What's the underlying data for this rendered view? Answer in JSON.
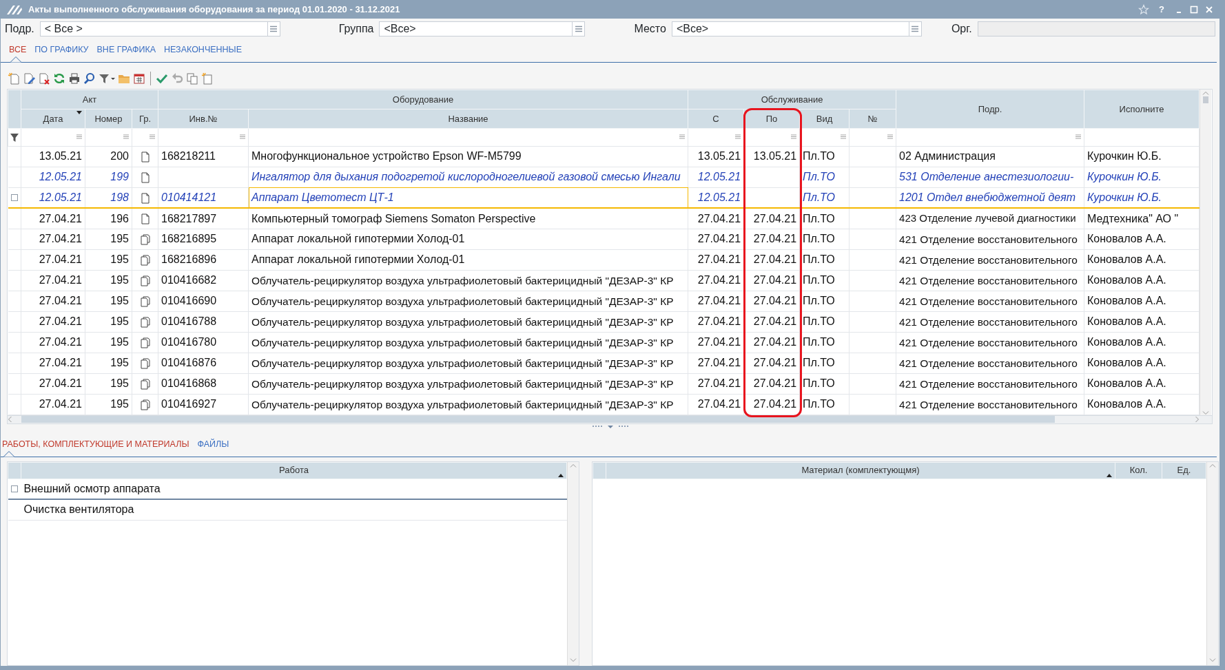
{
  "window": {
    "title": "Акты выполненного обслуживания оборудования за период 01.01.2020 - 31.12.2021",
    "help": "?"
  },
  "filters": [
    {
      "label": "Подр.",
      "value": "< Все >",
      "disabled": false
    },
    {
      "label": "Группа",
      "value": "<Все>",
      "disabled": false
    },
    {
      "label": "Место",
      "value": "<Все>",
      "disabled": false
    },
    {
      "label": "Орг.",
      "disabled": true
    }
  ],
  "tabs": [
    {
      "label": "ВСЕ",
      "selected": true
    },
    {
      "label": "ПО ГРАФИКУ",
      "selected": false
    },
    {
      "label": "ВНЕ ГРАФИКА",
      "selected": false
    },
    {
      "label": "НЕЗАКОНЧЕННЫЕ",
      "selected": false
    }
  ],
  "table": {
    "header": [
      {
        "label": "Акт",
        "columns": [
          {
            "label": "Дата",
            "sorted": true
          },
          {
            "label": "Номер",
            "sorted": false
          },
          {
            "label": "Гр.",
            "sorted": false
          }
        ]
      },
      {
        "label": "Оборудование",
        "columns": [
          {
            "label": "Инв.№",
            "sorted": false
          },
          {
            "label": "Название",
            "sorted": false
          }
        ]
      },
      {
        "label": "Обслуживание",
        "columns": [
          {
            "label": "С",
            "sorted": false
          },
          {
            "label": "По",
            "sorted": false,
            "highlighted": true
          },
          {
            "label": "Вид",
            "sorted": false
          },
          {
            "label": "№",
            "sorted": false
          }
        ]
      },
      {
        "label": "Подр.",
        "sorted": false
      },
      {
        "label": "Исполните",
        "sorted": false
      }
    ],
    "rows": [
      {
        "date": "13.05.21",
        "number": "200",
        "multi_doc": false,
        "inv_no": "168218211",
        "name": "Многофункциональное устройство Epson WF-M5799",
        "from": "13.05.21",
        "to": "13.05.21",
        "type": "Пл.ТО",
        "dept": "02 Администрация",
        "executor": "Курочкин Ю.Б.",
        "pending": false,
        "selected": false
      },
      {
        "date": "12.05.21",
        "number": "199",
        "multi_doc": false,
        "name": "Ингалятор для дыхания подогретой кислородногелиевой газовой смесью Ингали",
        "from": "12.05.21",
        "type": "Пл.ТО",
        "dept": "531 Отделение анестезиологии-",
        "executor": "Курочкин Ю.Б.",
        "pending": true,
        "selected": false
      },
      {
        "date": "12.05.21",
        "number": "198",
        "multi_doc": false,
        "inv_no": "010414121",
        "name": "Аппарат Цветотест ЦТ-1",
        "from": "12.05.21",
        "type": "Пл.ТО",
        "dept": "1201 Отдел внебюджетной деят",
        "executor": "Курочкин Ю.Б.",
        "pending": true,
        "selected": true
      },
      {
        "date": "27.04.21",
        "number": "196",
        "multi_doc": false,
        "inv_no": "168217897",
        "name": "Компьютерный томограф Siemens Somaton Perspective",
        "from": "27.04.21",
        "to": "27.04.21",
        "type": "Пл.ТО",
        "dept": "423 Отделение лучевой диагностики",
        "executor": "Медтехника\" АО \"",
        "pending": false,
        "selected": false
      },
      {
        "date": "27.04.21",
        "number": "195",
        "multi_doc": true,
        "inv_no": "168216895",
        "name": "Аппарат локальной гипотермии Холод-01",
        "from": "27.04.21",
        "to": "27.04.21",
        "type": "Пл.ТО",
        "dept": "421 Отделение восстановительного",
        "executor": "Коновалов А.А.",
        "pending": false,
        "selected": false
      },
      {
        "date": "27.04.21",
        "number": "195",
        "multi_doc": true,
        "inv_no": "168216896",
        "name": "Аппарат локальной гипотермии Холод-01",
        "from": "27.04.21",
        "to": "27.04.21",
        "type": "Пл.ТО",
        "dept": "421 Отделение восстановительного",
        "executor": "Коновалов А.А.",
        "pending": false,
        "selected": false
      },
      {
        "date": "27.04.21",
        "number": "195",
        "multi_doc": true,
        "inv_no": "010416682",
        "name": "Облучатель-рециркулятор воздуха ультрафиолетовый бактерицидный \"ДЕЗАР-3\" КР",
        "from": "27.04.21",
        "to": "27.04.21",
        "type": "Пл.ТО",
        "dept": "421 Отделение восстановительного",
        "executor": "Коновалов А.А.",
        "pending": false,
        "selected": false
      },
      {
        "date": "27.04.21",
        "number": "195",
        "multi_doc": true,
        "inv_no": "010416690",
        "name": "Облучатель-рециркулятор воздуха ультрафиолетовый бактерицидный \"ДЕЗАР-3\" КР",
        "from": "27.04.21",
        "to": "27.04.21",
        "type": "Пл.ТО",
        "dept": "421 Отделение восстановительного",
        "executor": "Коновалов А.А.",
        "pending": false,
        "selected": false
      },
      {
        "date": "27.04.21",
        "number": "195",
        "multi_doc": true,
        "inv_no": "010416788",
        "name": "Облучатель-рециркулятор воздуха ультрафиолетовый бактерицидный \"ДЕЗАР-3\" КР",
        "from": "27.04.21",
        "to": "27.04.21",
        "type": "Пл.ТО",
        "dept": "421 Отделение восстановительного",
        "executor": "Коновалов А.А.",
        "pending": false,
        "selected": false
      },
      {
        "date": "27.04.21",
        "number": "195",
        "multi_doc": true,
        "inv_no": "010416780",
        "name": "Облучатель-рециркулятор воздуха ультрафиолетовый бактерицидный \"ДЕЗАР-3\" КР",
        "from": "27.04.21",
        "to": "27.04.21",
        "type": "Пл.ТО",
        "dept": "421 Отделение восстановительного",
        "executor": "Коновалов А.А.",
        "pending": false,
        "selected": false
      },
      {
        "date": "27.04.21",
        "number": "195",
        "multi_doc": true,
        "inv_no": "010416876",
        "name": "Облучатель-рециркулятор воздуха ультрафиолетовый бактерицидный \"ДЕЗАР-3\" КР",
        "from": "27.04.21",
        "to": "27.04.21",
        "type": "Пл.ТО",
        "dept": "421 Отделение восстановительного",
        "executor": "Коновалов А.А.",
        "pending": false,
        "selected": false
      },
      {
        "date": "27.04.21",
        "number": "195",
        "multi_doc": true,
        "inv_no": "010416868",
        "name": "Облучатель-рециркулятор воздуха ультрафиолетовый бактерицидный \"ДЕЗАР-3\" КР",
        "from": "27.04.21",
        "to": "27.04.21",
        "type": "Пл.ТО",
        "dept": "421 Отделение восстановительного",
        "executor": "Коновалов А.А.",
        "pending": false,
        "selected": false
      },
      {
        "date": "27.04.21",
        "number": "195",
        "multi_doc": true,
        "inv_no": "010416927",
        "name": "Облучатель-рециркулятор воздуха ультрафиолетовый бактерицидный \"ДЕЗАР-3\" КР",
        "from": "27.04.21",
        "to": "27.04.21",
        "type": "Пл.ТО",
        "dept": "421 Отделение восстановительного",
        "executor": "Коновалов А.А.",
        "pending": false,
        "selected": false
      }
    ]
  },
  "detail_tabs": [
    {
      "label": "РАБОТЫ, КОМПЛЕКТУЮЩИЕ И МАТЕРИАЛЫ",
      "selected": true
    },
    {
      "label": "ФАЙЛЫ",
      "selected": false
    }
  ],
  "works": {
    "columns": [
      {
        "label": "Работа",
        "sorted": true
      }
    ],
    "rows": [
      {
        "text": "Внешний осмотр аппарата",
        "selected": true
      },
      {
        "text": "Очистка вентилятора",
        "selected": false
      }
    ]
  },
  "materials": {
    "columns": [
      {
        "label": "Материал (комплектующмя)",
        "sorted": true
      },
      {
        "label": "Кол.",
        "sorted": false
      },
      {
        "label": "Ед.",
        "sorted": false
      }
    ]
  }
}
